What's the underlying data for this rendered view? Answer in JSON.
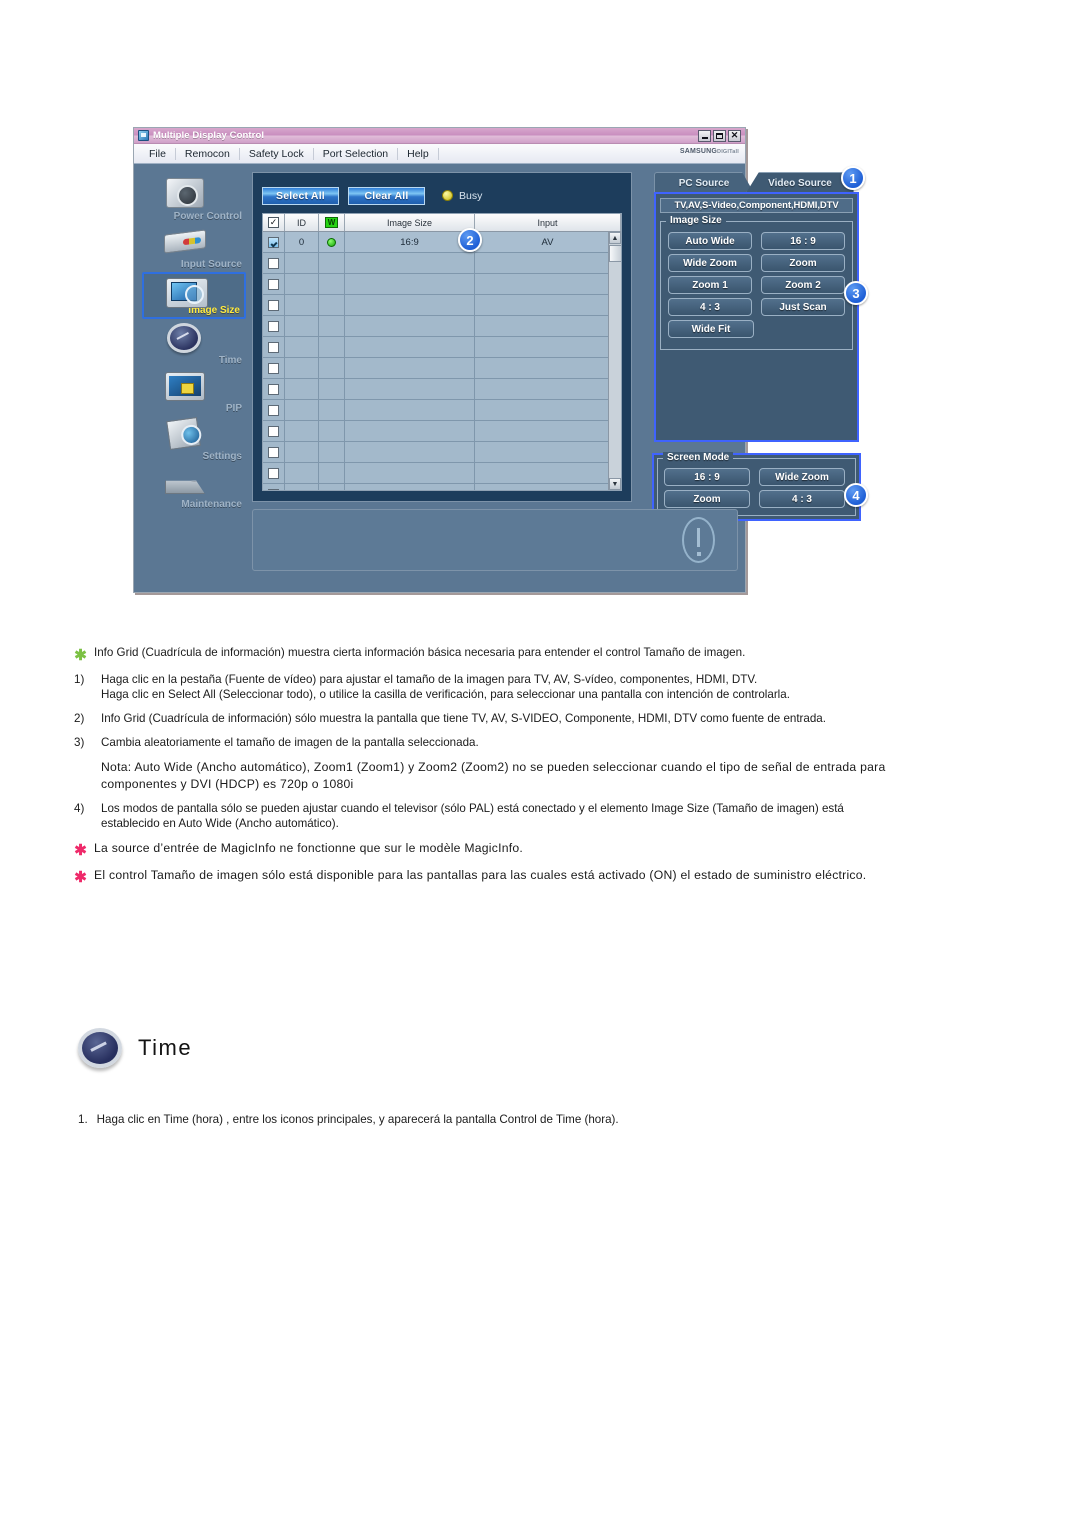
{
  "window": {
    "title": "Multiple Display Control",
    "app_icon": "app-icon",
    "brand": "SAMSUNG",
    "brand_suffix": "DIGITall",
    "controls": {
      "minimize": "_",
      "maximize": "□",
      "close": "✕"
    },
    "menu": [
      "File",
      "Remocon",
      "Safety Lock",
      "Port Selection",
      "Help"
    ]
  },
  "sidebar": {
    "items": [
      {
        "label": "Power Control",
        "icon": "power-control-icon",
        "selected": false
      },
      {
        "label": "Input Source",
        "icon": "input-source-icon",
        "selected": false
      },
      {
        "label": "Image Size",
        "icon": "image-size-icon",
        "selected": true
      },
      {
        "label": "Time",
        "icon": "time-icon",
        "selected": false
      },
      {
        "label": "PIP",
        "icon": "pip-icon",
        "selected": false
      },
      {
        "label": "Settings",
        "icon": "settings-icon",
        "selected": false
      },
      {
        "label": "Maintenance",
        "icon": "maintenance-icon",
        "selected": false
      }
    ]
  },
  "toolbar": {
    "select_all": "Select All",
    "clear_all": "Clear All",
    "busy_label": "Busy"
  },
  "grid": {
    "columns": [
      "☑",
      "ID",
      "PW",
      "Image Size",
      "Input"
    ],
    "rows": [
      {
        "checked": true,
        "id": "0",
        "power": "on",
        "image_size": "16:9",
        "input": "AV"
      },
      {
        "checked": false,
        "id": "",
        "power": "",
        "image_size": "",
        "input": ""
      },
      {
        "checked": false,
        "id": "",
        "power": "",
        "image_size": "",
        "input": ""
      },
      {
        "checked": false,
        "id": "",
        "power": "",
        "image_size": "",
        "input": ""
      },
      {
        "checked": false,
        "id": "",
        "power": "",
        "image_size": "",
        "input": ""
      },
      {
        "checked": false,
        "id": "",
        "power": "",
        "image_size": "",
        "input": ""
      },
      {
        "checked": false,
        "id": "",
        "power": "",
        "image_size": "",
        "input": ""
      },
      {
        "checked": false,
        "id": "",
        "power": "",
        "image_size": "",
        "input": ""
      },
      {
        "checked": false,
        "id": "",
        "power": "",
        "image_size": "",
        "input": ""
      },
      {
        "checked": false,
        "id": "",
        "power": "",
        "image_size": "",
        "input": ""
      },
      {
        "checked": false,
        "id": "",
        "power": "",
        "image_size": "",
        "input": ""
      },
      {
        "checked": false,
        "id": "",
        "power": "",
        "image_size": "",
        "input": ""
      },
      {
        "checked": false,
        "id": "",
        "power": "",
        "image_size": "",
        "input": ""
      }
    ],
    "scroll_up": "▲",
    "scroll_down": "▼"
  },
  "control_panel": {
    "tabs": [
      {
        "label": "PC Source",
        "active": false
      },
      {
        "label": "Video Source",
        "active": true
      }
    ],
    "source_banner": "TV,AV,S-Video,Component,HDMI,DTV",
    "image_size": {
      "legend": "Image Size",
      "buttons": [
        "Auto Wide",
        "16 : 9",
        "Wide Zoom",
        "Zoom",
        "Zoom 1",
        "Zoom 2",
        "4 : 3",
        "Just Scan",
        "Wide Fit"
      ]
    },
    "screen_mode": {
      "legend": "Screen Mode",
      "buttons": [
        "16 : 9",
        "Wide Zoom",
        "Zoom",
        "4 : 3"
      ]
    }
  },
  "badges": [
    "1",
    "2",
    "3",
    "4"
  ],
  "doc": {
    "b1_text": "Info Grid (Cuadrícula de información) muestra cierta información básica necesaria para entender el control Tamaño de imagen.",
    "n1_marker": "1)",
    "n1_text": "Haga clic en la pestaña (Fuente de vídeo) para ajustar el tamaño de la imagen para TV, AV, S-vídeo, componentes, HDMI, DTV.",
    "n1_text2": "Haga clic en Select All (Seleccionar todo), o utilice la casilla de verificación, para seleccionar una pantalla con intención de controlarla.",
    "n2_marker": "2)",
    "n2_text": "Info Grid (Cuadrícula de información) sólo muestra la pantalla que tiene TV, AV, S-VIDEO, Componente, HDMI, DTV como fuente de entrada.",
    "n3_marker": "3)",
    "n3_text": "Cambia aleatoriamente el tamaño de imagen de la pantalla seleccionada.",
    "note_text": "Nota: Auto Wide (Ancho automático), Zoom1 (Zoom1) y Zoom2 (Zoom2) no se pueden seleccionar cuando el tipo de señal de entrada para componentes y DVI (HDCP) es 720p o 1080i",
    "n4_marker": "4)",
    "n4_text": "Los modos de pantalla sólo se pueden ajustar cuando el televisor (sólo PAL) está conectado y el elemento Image Size (Tamaño de imagen) está establecido en Auto Wide (Ancho automático).",
    "b2_text": "La source d’entrée de MagicInfo ne fonctionne que sur le modèle MagicInfo.",
    "b3_text": "El control Tamaño de imagen sólo está disponible para las pantallas para las cuales está activado (ON) el estado de suministro eléctrico.",
    "star_green": "✱",
    "star_red": "✱"
  },
  "time_section": {
    "icon": "time-clock-icon",
    "title": "Time",
    "step_marker": "1.",
    "step_text": "Haga clic en Time (hora) , entre los iconos principales, y aparecerá la pantalla Control de Time (hora)."
  },
  "colors": {
    "window_bg": "#5b7793",
    "titlebar": "#c98fc0",
    "panel_bg": "#3f5a73",
    "accent_blue": "#3f63ff",
    "badge_blue": "#1f5fd6",
    "grid_bg": "#a3b9cb",
    "selected_label": "#ffe93f",
    "star_green": "#7cc144",
    "star_red": "#ef2a6a"
  }
}
